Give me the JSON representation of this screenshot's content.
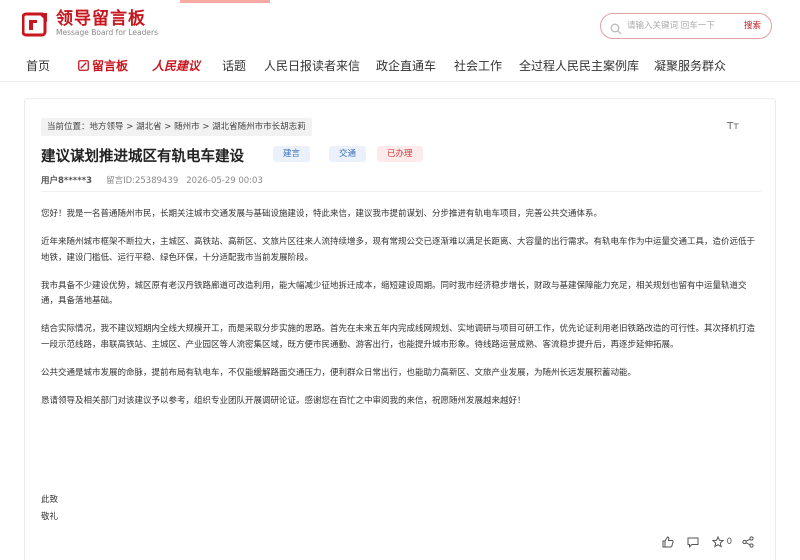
{
  "header": {
    "logo_cn": "领导留言板",
    "logo_en": "Message Board for Leaders",
    "search_placeholder": "请输入关键词 回车一下",
    "search_button": "搜索",
    "brand_color": "#c8161e"
  },
  "nav": {
    "items": [
      {
        "label": "首页",
        "icon": ""
      },
      {
        "label": "留言板",
        "icon": "pen-icon"
      },
      {
        "label": "人民建议",
        "icon": ""
      },
      {
        "label": "话题",
        "icon": ""
      },
      {
        "label": "人民日报读者来信",
        "icon": ""
      },
      {
        "label": "政企直通车",
        "icon": ""
      },
      {
        "label": "社会工作",
        "icon": ""
      },
      {
        "label": "全过程人民民主案例库",
        "icon": ""
      },
      {
        "label": "凝聚服务群众",
        "icon": ""
      }
    ]
  },
  "breadcrumb": {
    "prefix": "当前位置：",
    "items": [
      "地方领导",
      "湖北省",
      "随州市",
      "湖北省随州市市长胡志莉"
    ],
    "separator": ">"
  },
  "font_toggle": "Tт",
  "post": {
    "title": "建议谋划推进城区有轨电车建设",
    "tags": [
      "建言",
      "交通",
      "已办理"
    ],
    "user": "用户8*****3",
    "id_label": "留言ID:25389439",
    "datetime": "2026-05-29 00:03",
    "paragraphs": [
      "您好！我是一名普通随州市民，长期关注城市交通发展与基础设施建设，特此来信，建议我市提前谋划、分步推进有轨电车项目，完善公共交通体系。",
      "近年来随州城市框架不断拉大，主城区、高铁站、高新区、文旅片区往来人流持续增多，现有常规公交已逐渐难以满足长距离、大容量的出行需求。有轨电车作为中运量交通工具，造价远低于地铁，建设门槛低、运行平稳、绿色环保，十分适配我市当前发展阶段。",
      "我市具备不少建设优势，城区原有老汉丹铁路廊道可改造利用，能大幅减少征地拆迁成本，缩短建设周期。同时我市经济稳步增长，财政与基建保障能力充足，相关规划也留有中运量轨道交通，具备落地基础。",
      "结合实际情况，我不建议短期内全线大规模开工，而是采取分步实施的思路。首先在未来五年内完成线网规划、实地调研与项目可研工作，优先论证利用老旧铁路改造的可行性。其次择机打造一段示范线路，串联高铁站、主城区、产业园区等人流密集区域，既方便市民通勤、游客出行，也能提升城市形象。待线路运营成熟、客流稳步提升后，再逐步延伸拓展。",
      "公共交通是城市发展的命脉，提前布局有轨电车，不仅能缓解路面交通压力，便利群众日常出行，也能助力高新区、文旅产业发展，为随州长远发展积蓄动能。",
      "恳请领导及相关部门对该建议予以参考，组织专业团队开展调研论证。感谢您在百忙之中审阅我的来信，祝愿随州发展越来越好！"
    ],
    "closing": [
      "此致",
      "敬礼"
    ]
  },
  "actions": {
    "like_count": "",
    "comment_count": "",
    "collect_count": "0"
  },
  "colors": {
    "tag_blue_bg": "#eaf1fb",
    "tag_blue_text": "#3b6fb6",
    "tag_red_bg": "#fdeaea",
    "tag_red_text": "#d23c3c"
  }
}
